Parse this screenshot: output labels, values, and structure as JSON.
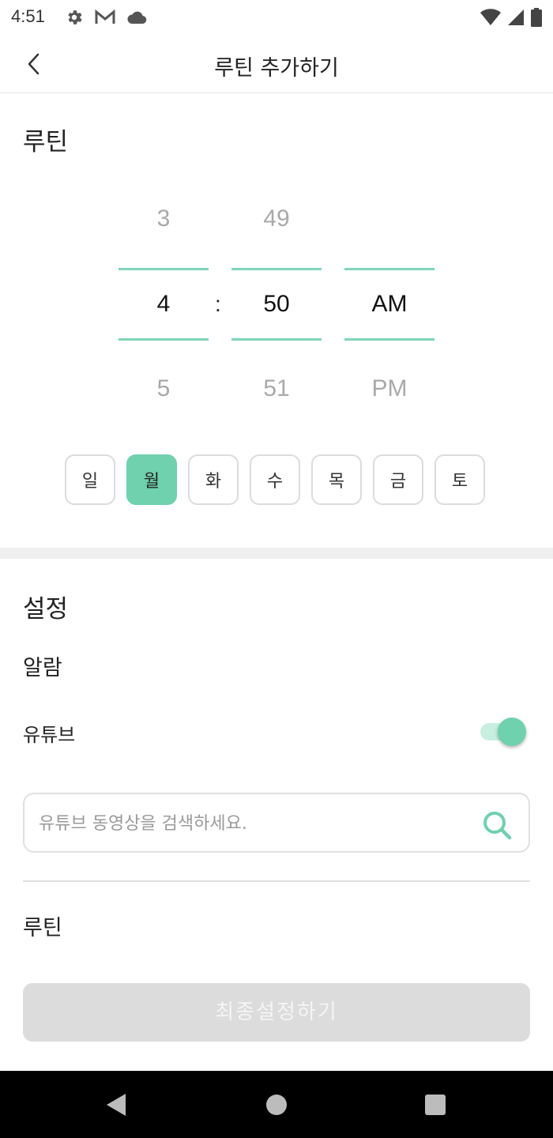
{
  "status_bar": {
    "time": "4:51",
    "icons_left": [
      "gear-icon",
      "gmail-icon",
      "cloud-icon"
    ],
    "icons_right": [
      "wifi-icon",
      "cell-signal-icon",
      "battery-icon"
    ]
  },
  "app_bar": {
    "title": "루틴 추가하기",
    "back_icon": "chevron-left-icon"
  },
  "routine": {
    "section_title": "루틴",
    "picker": {
      "hour": {
        "prev": "3",
        "selected": "4",
        "next": "5"
      },
      "colon": ":",
      "minute": {
        "prev": "49",
        "selected": "50",
        "next": "51"
      },
      "period": {
        "prev": "",
        "selected": "AM",
        "next": "PM"
      }
    },
    "days": [
      {
        "label": "일",
        "selected": false
      },
      {
        "label": "월",
        "selected": true
      },
      {
        "label": "화",
        "selected": false
      },
      {
        "label": "수",
        "selected": false
      },
      {
        "label": "목",
        "selected": false
      },
      {
        "label": "금",
        "selected": false
      },
      {
        "label": "토",
        "selected": false
      }
    ]
  },
  "settings": {
    "section_title": "설정",
    "alarm_label": "알람",
    "youtube_label": "유튜브",
    "youtube_enabled": true,
    "search_placeholder": "유튜브 동영상을 검색하세요.",
    "search_value": "",
    "routine_label": "루틴"
  },
  "final_button": "최종설정하기",
  "colors": {
    "accent": "#6fd1ad",
    "accent_light": "#c8eee0",
    "picker_line": "#7ed5b7",
    "button_disabled": "#dcdcdc"
  }
}
